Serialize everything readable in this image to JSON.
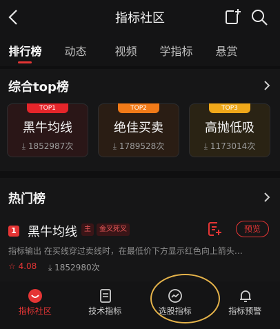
{
  "header": {
    "title": "指标社区"
  },
  "tabs": [
    {
      "label": "排行榜",
      "active": true
    },
    {
      "label": "动态"
    },
    {
      "label": "视频"
    },
    {
      "label": "学指标"
    },
    {
      "label": "悬赏"
    }
  ],
  "top_section": {
    "title": "综合top榜",
    "cards": [
      {
        "badge": "TOP1",
        "name": "黑牛均线",
        "count": "1852987次",
        "badge_color": "#e5252a"
      },
      {
        "badge": "TOP2",
        "name": "绝佳买卖",
        "count": "1789528次",
        "badge_color": "#f17a18"
      },
      {
        "badge": "TOP3",
        "name": "高抛低吸",
        "count": "1173014次",
        "badge_color": "#f0a81a"
      }
    ]
  },
  "hot_section": {
    "title": "热门榜",
    "item": {
      "rank": "1",
      "name": "黑牛均线",
      "tags": [
        "主",
        "金叉死叉"
      ],
      "preview_label": "预览",
      "description": "指标输出 在买线穿过卖线时，在最低价下方显示红色向上箭头…",
      "score": "4.08",
      "count": "1852980次"
    }
  },
  "bottom_nav": [
    {
      "label": "指标社区",
      "icon": "community-icon",
      "active": true
    },
    {
      "label": "技术指标",
      "icon": "document-icon"
    },
    {
      "label": "选股指标",
      "icon": "trend-icon"
    },
    {
      "label": "指标预警",
      "icon": "bell-icon"
    }
  ],
  "colors": {
    "accent": "#e53535",
    "highlight": "#e5b34a"
  }
}
